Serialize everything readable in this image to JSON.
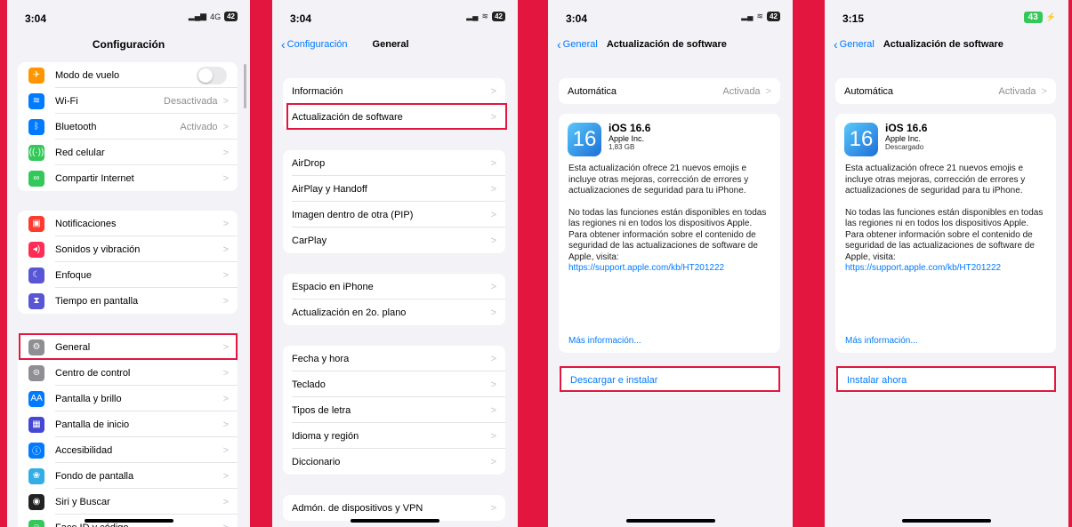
{
  "accent_color": "#e2163f",
  "link_color": "#007aff",
  "screen1": {
    "time": "3:04",
    "network": "4G",
    "battery": "42",
    "title": "Configuración",
    "groups": [
      [
        {
          "label": "Modo de vuelo",
          "icon": "airplane-icon",
          "color": "#ff9500",
          "glyph": "✈",
          "toggle": true
        },
        {
          "label": "Wi-Fi",
          "icon": "wifi-icon",
          "color": "#007aff",
          "glyph": "≋",
          "value": "Desactivada"
        },
        {
          "label": "Bluetooth",
          "icon": "bluetooth-icon",
          "color": "#007aff",
          "glyph": "ᛒ",
          "value": "Activado"
        },
        {
          "label": "Red celular",
          "icon": "cellular-icon",
          "color": "#34c759",
          "glyph": "((·))"
        },
        {
          "label": "Compartir Internet",
          "icon": "hotspot-icon",
          "color": "#34c759",
          "glyph": "∞"
        }
      ],
      [
        {
          "label": "Notificaciones",
          "icon": "notifications-icon",
          "color": "#ff3b30",
          "glyph": "▣"
        },
        {
          "label": "Sonidos y vibración",
          "icon": "sound-icon",
          "color": "#ff2d55",
          "glyph": "◂)"
        },
        {
          "label": "Enfoque",
          "icon": "focus-moon-icon",
          "color": "#5856d6",
          "glyph": "☾"
        },
        {
          "label": "Tiempo en pantalla",
          "icon": "hourglass-icon",
          "color": "#5856d6",
          "glyph": "⧗"
        }
      ],
      [
        {
          "label": "General",
          "icon": "gear-icon",
          "color": "#8e8e93",
          "glyph": "⚙"
        },
        {
          "label": "Centro de control",
          "icon": "control-center-icon",
          "color": "#8e8e93",
          "glyph": "⊜"
        },
        {
          "label": "Pantalla y brillo",
          "icon": "display-brightness-icon",
          "color": "#007aff",
          "glyph": "AA"
        },
        {
          "label": "Pantalla de inicio",
          "icon": "home-screen-icon",
          "color": "#4547d5",
          "glyph": "▦"
        },
        {
          "label": "Accesibilidad",
          "icon": "accessibility-icon",
          "color": "#007aff",
          "glyph": "ⓘ"
        },
        {
          "label": "Fondo de pantalla",
          "icon": "wallpaper-icon",
          "color": "#32ade6",
          "glyph": "❀"
        },
        {
          "label": "Siri y Buscar",
          "icon": "siri-icon",
          "color": "#222222",
          "glyph": "◉"
        },
        {
          "label": "Face ID y código",
          "icon": "face-id-icon",
          "color": "#34c759",
          "glyph": "☺"
        }
      ]
    ]
  },
  "screen2": {
    "time": "3:04",
    "battery": "42",
    "back": "Configuración",
    "title": "General",
    "groups": [
      [
        "Información",
        "Actualización de software"
      ],
      [
        "AirDrop",
        "AirPlay y Handoff",
        "Imagen dentro de otra (PIP)",
        "CarPlay"
      ],
      [
        "Espacio en iPhone",
        "Actualización en 2o. plano"
      ],
      [
        "Fecha y hora",
        "Teclado",
        "Tipos de letra",
        "Idioma y región",
        "Diccionario"
      ],
      [
        "Admón. de dispositivos y VPN"
      ]
    ]
  },
  "screen3": {
    "time": "3:04",
    "battery": "42",
    "back": "General",
    "title": "Actualización de software",
    "auto_label": "Automática",
    "auto_value": "Activada",
    "update_name": "iOS 16.6",
    "vendor": "Apple Inc.",
    "meta": "1,83 GB",
    "logo_text": "16",
    "desc1": "Esta actualización ofrece 21 nuevos emojis e incluye otras mejoras, corrección de errores y actualizaciones de seguridad para tu iPhone.",
    "desc2": "No todas las funciones están disponibles en todas las regiones ni en todos los dispositivos Apple. Para obtener información sobre el contenido de seguridad de las actualizaciones de software de Apple, visita:",
    "url": "https://support.apple.com/kb/HT201222",
    "more": "Más información...",
    "action": "Descargar e instalar"
  },
  "screen4": {
    "time": "3:15",
    "battery": "43",
    "back": "General",
    "title": "Actualización de software",
    "auto_label": "Automática",
    "auto_value": "Activada",
    "update_name": "iOS 16.6",
    "vendor": "Apple Inc.",
    "meta": "Descargado",
    "logo_text": "16",
    "desc1": "Esta actualización ofrece 21 nuevos emojis e incluye otras mejoras, corrección de errores y actualizaciones de seguridad para tu iPhone.",
    "desc2": "No todas las funciones están disponibles en todas las regiones ni en todos los dispositivos Apple. Para obtener información sobre el contenido de seguridad de las actualizaciones de software de Apple, visita:",
    "url": "https://support.apple.com/kb/HT201222",
    "more": "Más información...",
    "action": "Instalar ahora"
  }
}
